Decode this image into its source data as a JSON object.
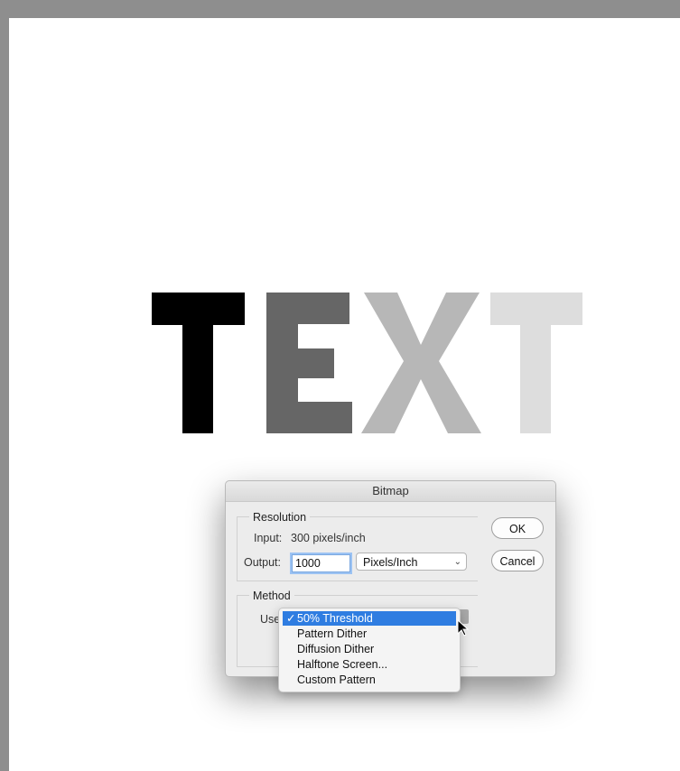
{
  "artwork": {
    "letters": [
      {
        "char": "T",
        "color": "#000000"
      },
      {
        "char": "E",
        "color": "#666666"
      },
      {
        "char": "X",
        "color": "#b7b7b7"
      },
      {
        "char": "T",
        "color": "#dddddd"
      }
    ]
  },
  "dialog": {
    "title": "Bitmap",
    "resolution": {
      "legend": "Resolution",
      "input_label": "Input:",
      "input_value": "300 pixels/inch",
      "output_label": "Output:",
      "output_value": "1000",
      "unit_value": "Pixels/Inch"
    },
    "method": {
      "legend": "Method",
      "use_label": "Use"
    },
    "ok_label": "OK",
    "cancel_label": "Cancel"
  },
  "menu": {
    "check_mark": "✓",
    "items": [
      "50% Threshold",
      "Pattern Dither",
      "Diffusion Dither",
      "Halftone Screen...",
      "Custom Pattern"
    ],
    "selected": "50% Threshold"
  },
  "colors": {
    "selection": "#2f7de1",
    "canvas_bg": "#ffffff",
    "workspace_bg": "#8e8e8e"
  }
}
